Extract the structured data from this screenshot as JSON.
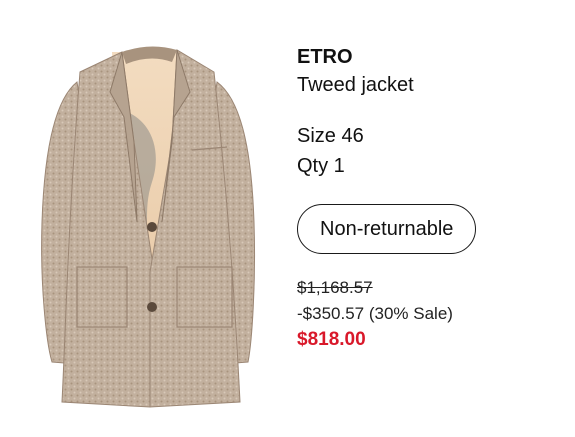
{
  "product": {
    "brand": "ETRO",
    "name": "Tweed jacket",
    "size": "Size 46",
    "qty": "Qty 1",
    "returnable_badge": "Non-returnable",
    "price_original": "$1,168.57",
    "price_discount": "-$350.57 (30% Sale)",
    "price_final": "$818.00"
  },
  "colors": {
    "sale_price": "#d9182a",
    "jacket": "#c2b09e",
    "lining": "#e8c9a6"
  },
  "icons": {
    "product_image": "tweed-jacket-image"
  }
}
